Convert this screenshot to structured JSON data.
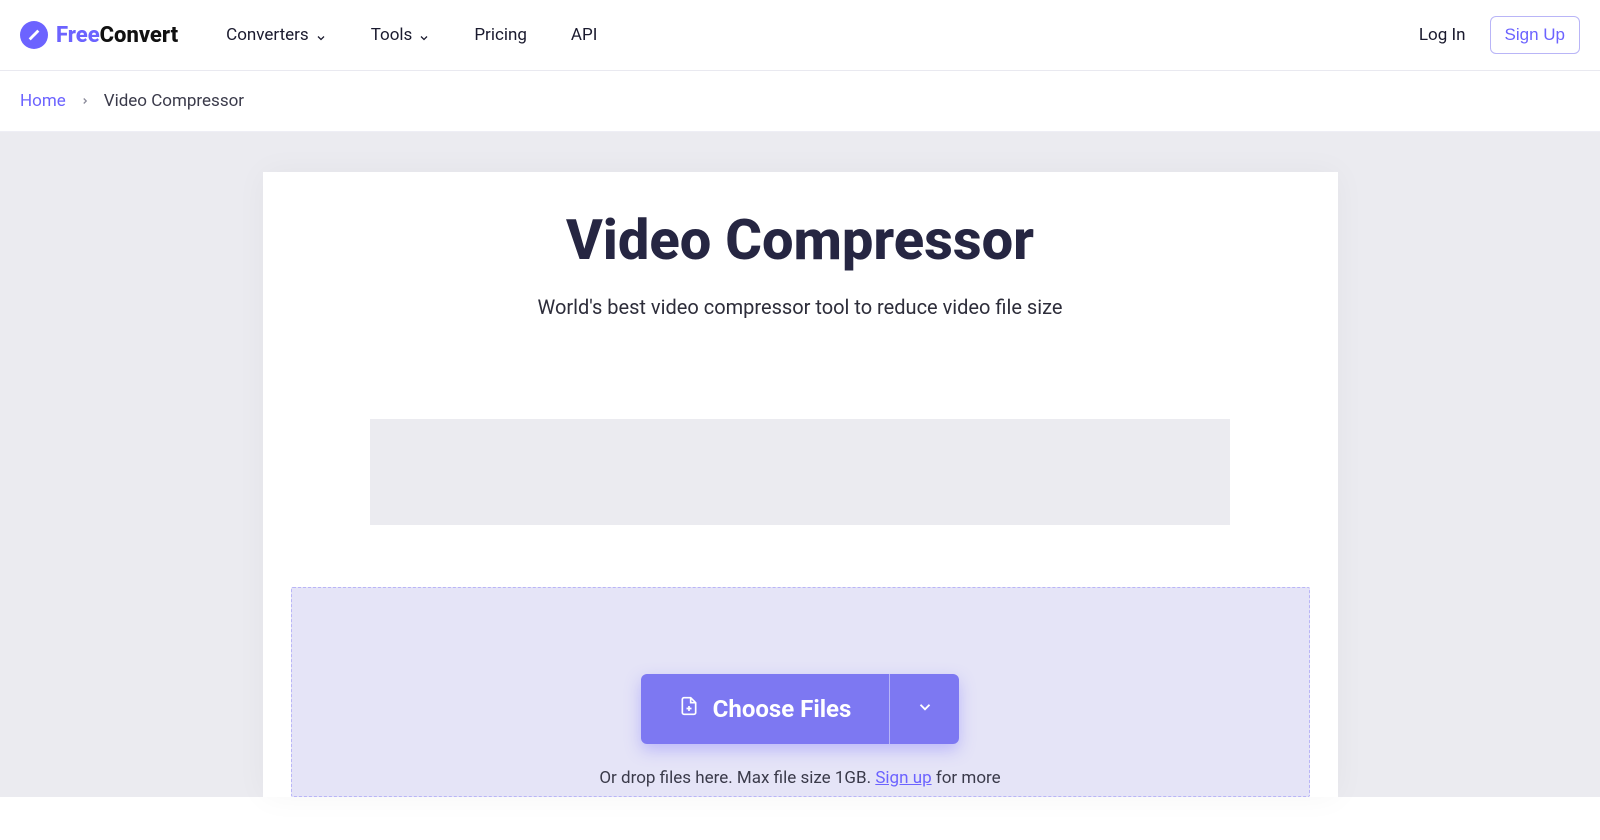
{
  "header": {
    "logo": {
      "free": "Free",
      "convert": "Convert"
    },
    "nav": {
      "converters": "Converters",
      "tools": "Tools",
      "pricing": "Pricing",
      "api": "API"
    },
    "login": "Log In",
    "signup": "Sign Up"
  },
  "breadcrumb": {
    "home": "Home",
    "current": "Video Compressor"
  },
  "main": {
    "title": "Video Compressor",
    "subtitle": "World's best video compressor tool to reduce video file size",
    "choose_label": "Choose Files",
    "drop_prefix": "Or drop files here. Max file size 1GB. ",
    "drop_signup": "Sign up",
    "drop_suffix": " for more"
  }
}
